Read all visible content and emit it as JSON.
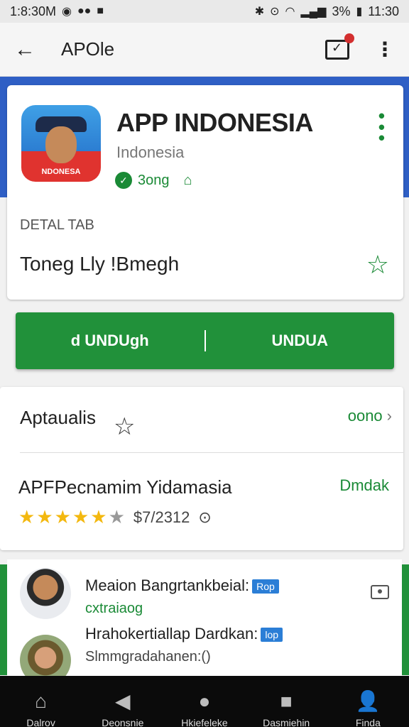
{
  "status": {
    "left_time": "1:8:30M",
    "right_time": "11:30",
    "battery": "3%"
  },
  "appbar": {
    "title": "APOle"
  },
  "app": {
    "name": "APP INDONESIA",
    "subtitle": "Indonesia",
    "icon_text": "NDONESA",
    "rating_text": "3ong",
    "detail_tab": "DETAL TAB",
    "detail_line": "Toneg Lly !Bmegh"
  },
  "buttons": {
    "left": "d UNDUgh",
    "right": "UNDUA"
  },
  "info": {
    "row1_label": "Aptaualis",
    "row1_link": "oono",
    "row2_label": "APFPecnamim Yidamasia",
    "row2_action": "Dmdak",
    "rating_meta": "$7/2312",
    "stars_full": 5,
    "stars_total": 6
  },
  "reviews": [
    {
      "name": "Meaion Bangrtankbeial:",
      "tag": "Rop",
      "subtitle": "cxtraiaog"
    },
    {
      "name": "Hrahokertiallap Dardkan:",
      "tag": "lop",
      "subtitle": "Slmmgradahanen:()"
    }
  ],
  "nav": [
    {
      "icon": "home-icon",
      "label": "Dalrov"
    },
    {
      "icon": "back-triangle-icon",
      "label": "Deonsnie"
    },
    {
      "icon": "circle-icon",
      "label": "Hkiefeleke"
    },
    {
      "icon": "square-icon",
      "label": "Dasmiehin"
    },
    {
      "icon": "person-icon",
      "label": "Finda"
    }
  ]
}
